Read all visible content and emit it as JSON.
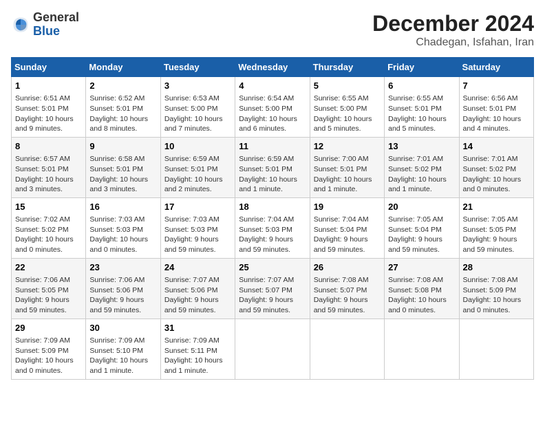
{
  "logo": {
    "general": "General",
    "blue": "Blue"
  },
  "header": {
    "month": "December 2024",
    "location": "Chadegan, Isfahan, Iran"
  },
  "weekdays": [
    "Sunday",
    "Monday",
    "Tuesday",
    "Wednesday",
    "Thursday",
    "Friday",
    "Saturday"
  ],
  "weeks": [
    [
      {
        "day": "1",
        "info": "Sunrise: 6:51 AM\nSunset: 5:01 PM\nDaylight: 10 hours and 9 minutes."
      },
      {
        "day": "2",
        "info": "Sunrise: 6:52 AM\nSunset: 5:01 PM\nDaylight: 10 hours and 8 minutes."
      },
      {
        "day": "3",
        "info": "Sunrise: 6:53 AM\nSunset: 5:00 PM\nDaylight: 10 hours and 7 minutes."
      },
      {
        "day": "4",
        "info": "Sunrise: 6:54 AM\nSunset: 5:00 PM\nDaylight: 10 hours and 6 minutes."
      },
      {
        "day": "5",
        "info": "Sunrise: 6:55 AM\nSunset: 5:00 PM\nDaylight: 10 hours and 5 minutes."
      },
      {
        "day": "6",
        "info": "Sunrise: 6:55 AM\nSunset: 5:01 PM\nDaylight: 10 hours and 5 minutes."
      },
      {
        "day": "7",
        "info": "Sunrise: 6:56 AM\nSunset: 5:01 PM\nDaylight: 10 hours and 4 minutes."
      }
    ],
    [
      {
        "day": "8",
        "info": "Sunrise: 6:57 AM\nSunset: 5:01 PM\nDaylight: 10 hours and 3 minutes."
      },
      {
        "day": "9",
        "info": "Sunrise: 6:58 AM\nSunset: 5:01 PM\nDaylight: 10 hours and 3 minutes."
      },
      {
        "day": "10",
        "info": "Sunrise: 6:59 AM\nSunset: 5:01 PM\nDaylight: 10 hours and 2 minutes."
      },
      {
        "day": "11",
        "info": "Sunrise: 6:59 AM\nSunset: 5:01 PM\nDaylight: 10 hours and 1 minute."
      },
      {
        "day": "12",
        "info": "Sunrise: 7:00 AM\nSunset: 5:01 PM\nDaylight: 10 hours and 1 minute."
      },
      {
        "day": "13",
        "info": "Sunrise: 7:01 AM\nSunset: 5:02 PM\nDaylight: 10 hours and 1 minute."
      },
      {
        "day": "14",
        "info": "Sunrise: 7:01 AM\nSunset: 5:02 PM\nDaylight: 10 hours and 0 minutes."
      }
    ],
    [
      {
        "day": "15",
        "info": "Sunrise: 7:02 AM\nSunset: 5:02 PM\nDaylight: 10 hours and 0 minutes."
      },
      {
        "day": "16",
        "info": "Sunrise: 7:03 AM\nSunset: 5:03 PM\nDaylight: 10 hours and 0 minutes."
      },
      {
        "day": "17",
        "info": "Sunrise: 7:03 AM\nSunset: 5:03 PM\nDaylight: 9 hours and 59 minutes."
      },
      {
        "day": "18",
        "info": "Sunrise: 7:04 AM\nSunset: 5:03 PM\nDaylight: 9 hours and 59 minutes."
      },
      {
        "day": "19",
        "info": "Sunrise: 7:04 AM\nSunset: 5:04 PM\nDaylight: 9 hours and 59 minutes."
      },
      {
        "day": "20",
        "info": "Sunrise: 7:05 AM\nSunset: 5:04 PM\nDaylight: 9 hours and 59 minutes."
      },
      {
        "day": "21",
        "info": "Sunrise: 7:05 AM\nSunset: 5:05 PM\nDaylight: 9 hours and 59 minutes."
      }
    ],
    [
      {
        "day": "22",
        "info": "Sunrise: 7:06 AM\nSunset: 5:05 PM\nDaylight: 9 hours and 59 minutes."
      },
      {
        "day": "23",
        "info": "Sunrise: 7:06 AM\nSunset: 5:06 PM\nDaylight: 9 hours and 59 minutes."
      },
      {
        "day": "24",
        "info": "Sunrise: 7:07 AM\nSunset: 5:06 PM\nDaylight: 9 hours and 59 minutes."
      },
      {
        "day": "25",
        "info": "Sunrise: 7:07 AM\nSunset: 5:07 PM\nDaylight: 9 hours and 59 minutes."
      },
      {
        "day": "26",
        "info": "Sunrise: 7:08 AM\nSunset: 5:07 PM\nDaylight: 9 hours and 59 minutes."
      },
      {
        "day": "27",
        "info": "Sunrise: 7:08 AM\nSunset: 5:08 PM\nDaylight: 10 hours and 0 minutes."
      },
      {
        "day": "28",
        "info": "Sunrise: 7:08 AM\nSunset: 5:09 PM\nDaylight: 10 hours and 0 minutes."
      }
    ],
    [
      {
        "day": "29",
        "info": "Sunrise: 7:09 AM\nSunset: 5:09 PM\nDaylight: 10 hours and 0 minutes."
      },
      {
        "day": "30",
        "info": "Sunrise: 7:09 AM\nSunset: 5:10 PM\nDaylight: 10 hours and 1 minute."
      },
      {
        "day": "31",
        "info": "Sunrise: 7:09 AM\nSunset: 5:11 PM\nDaylight: 10 hours and 1 minute."
      },
      null,
      null,
      null,
      null
    ]
  ]
}
